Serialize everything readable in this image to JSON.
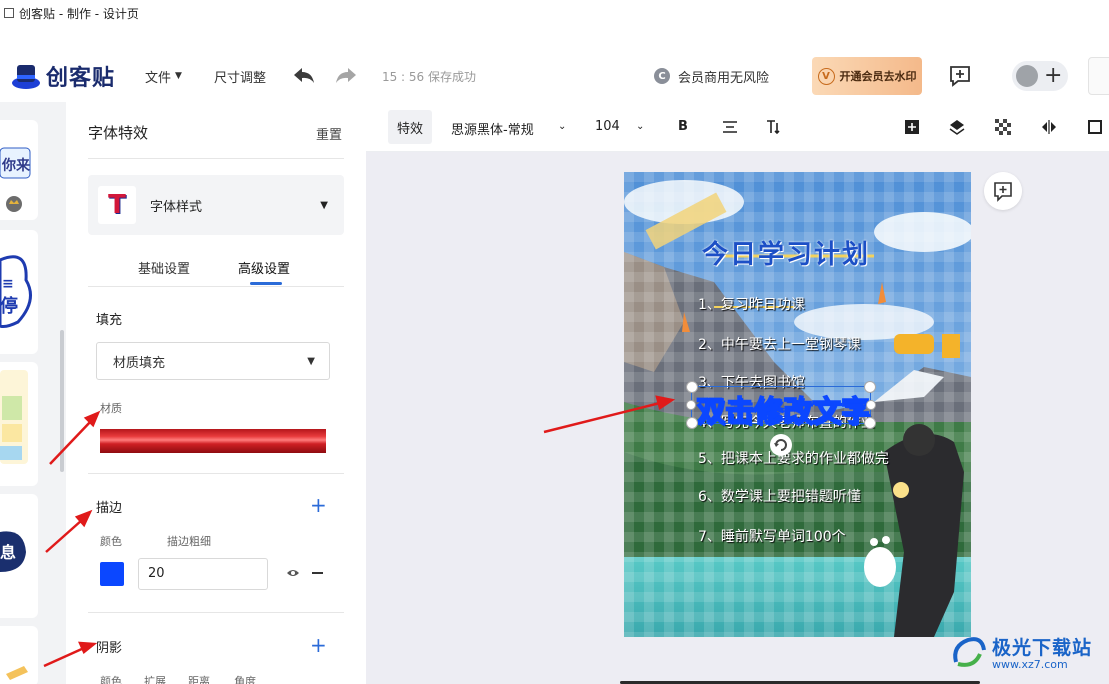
{
  "titlebar": {
    "title": "创客贴 - 制作 - 设计页"
  },
  "header": {
    "logo_text": "创客贴",
    "menu_file": "文件",
    "menu_resize": "尺寸调整",
    "save_status": "15 : 56 保存成功",
    "commercial_icon_letter": "C",
    "commercial_text": "会员商用无风险",
    "vip_icon_letter": "V",
    "vip_button": "开通会员去水印",
    "avatar_plus": "+"
  },
  "panel": {
    "title": "字体特效",
    "reset": "重置",
    "style_label": "字体样式",
    "style_thumb_letter": "T",
    "tabs": [
      "基础设置",
      "高级设置"
    ],
    "active_tab": "高级设置",
    "fill_label": "填充",
    "fill_select": "材质填充",
    "material_label": "材质",
    "stroke_label": "描边",
    "stroke_color_label": "颜色",
    "stroke_width_label": "描边粗细",
    "stroke_width_value": "20",
    "stroke_color": "#0b47ff",
    "shadow_label": "阴影",
    "shadow_cols": [
      "颜色",
      "扩展",
      "距离",
      "角度"
    ],
    "plus": "+"
  },
  "toolbar": {
    "effects": "特效",
    "font_family": "思源黑体-常规",
    "font_size": "104"
  },
  "poster": {
    "title": "今日学习计划",
    "items": [
      "1、复习昨日功课",
      "2、中午要去上一堂钢琴课",
      "3、下午去图书馆",
      "4、写完今天老师布置的作业",
      "5、把课本上要求的作业都做完",
      "6、数学课上要把错题听懂",
      "7、睡前默写单词100个"
    ],
    "selected_text": "双击修改文字"
  },
  "watermark": {
    "name": "极光下载站",
    "url": "www.xz7.com"
  },
  "colors": {
    "accent": "#2b6bd8",
    "arrow": "#e01a1a",
    "selection_text": "#d3173a"
  }
}
